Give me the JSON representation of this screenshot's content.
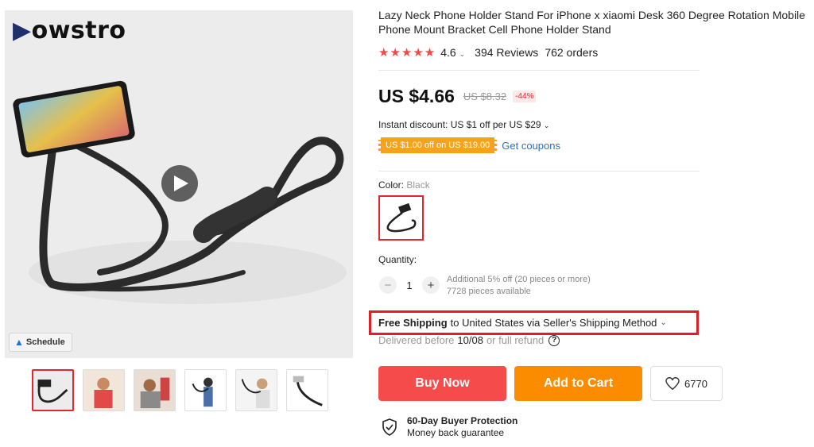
{
  "brand": {
    "logo_text": "owstro"
  },
  "gallery": {
    "schedule_label": "Schedule",
    "thumbnails": [
      "thumb-1",
      "thumb-2",
      "thumb-3",
      "thumb-4",
      "thumb-5",
      "thumb-6"
    ],
    "active_index": 0
  },
  "product": {
    "title": "Lazy Neck Phone Holder Stand For iPhone x xiaomi Desk 360 Degree Rotation Mobile Phone Mount Bracket Cell Phone Holder Stand",
    "stars": "★★★★★",
    "rating": "4.6",
    "reviews": "394 Reviews",
    "orders": "762 orders"
  },
  "price": {
    "current": "US $4.66",
    "original": "US $8.32",
    "discount": "-44%",
    "instant_discount": "Instant discount: US $1 off per US $29",
    "coupon_tag": "US $1.00 off on US $19.00",
    "get_coupons": "Get coupons"
  },
  "color": {
    "label": "Color:",
    "selected": "Black"
  },
  "quantity": {
    "label": "Quantity:",
    "value": "1",
    "minus": "−",
    "plus": "+",
    "note_line1": "Additional 5% off (20 pieces or more)",
    "note_line2": "7728 pieces available"
  },
  "shipping": {
    "bold": "Free Shipping",
    "rest": "to United States via Seller's Shipping Method",
    "delivered_prefix": "Delivered before",
    "delivered_date": "10/08",
    "delivered_suffix": "or full refund"
  },
  "actions": {
    "buy_now": "Buy Now",
    "add_to_cart": "Add to Cart",
    "wishlist_count": "6770"
  },
  "protection": {
    "title": "60-Day Buyer Protection",
    "subtitle": "Money back guarantee"
  },
  "colors": {
    "accent_red": "#e6262e",
    "buy_now": "#f54b4b",
    "add_cart": "#fb8c00",
    "coupon": "#f7a21b",
    "link": "#2e70c0"
  }
}
